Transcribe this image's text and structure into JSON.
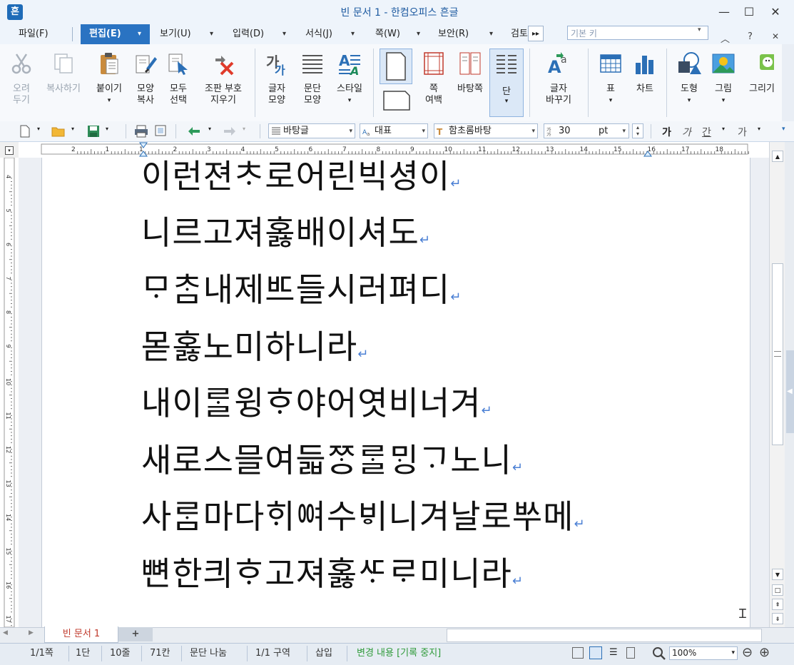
{
  "window": {
    "title": "빈 문서 1 - 한컴오피스 흔글",
    "app_icon_glyph": "흔",
    "minimize": "—",
    "maximize": "☐",
    "close": "✕"
  },
  "menu": {
    "file": "파일(F)",
    "edit": "편집(E)",
    "view": "보기(U)",
    "input": "입력(D)",
    "format": "서식(J)",
    "page": "쪽(W)",
    "security": "보안(R)",
    "review": "검토",
    "arrow": "▾",
    "more": "▸▸",
    "style_box_placeholder": "기본 키",
    "ribbon_collapse": "︿",
    "help": "?",
    "close_doc": "✕"
  },
  "ribbon": {
    "cut": "오려\n두기",
    "copy": "복사하기",
    "paste": "붙이기",
    "format_copy": "모양\n복사",
    "select_all": "모두\n선택",
    "remove_format": "조판 부호\n지우기",
    "char_shape": "글자\n모양",
    "para_shape": "문단\n모양",
    "style": "스타일",
    "page_margin": "쪽\n여백",
    "background": "바탕쪽",
    "column": "단",
    "char_change": "글자\n바꾸기",
    "table": "표",
    "chart": "차트",
    "shape": "도형",
    "picture": "그림",
    "draw": "그리기"
  },
  "toolbar2": {
    "style_combo": "바탕글",
    "lang_combo": "대표",
    "font_combo": "함초롬바탕",
    "size_value": "30",
    "size_unit": "pt",
    "bold": "가",
    "italic": "가",
    "underline": "간",
    "strike": "가"
  },
  "ruler": {
    "h_numbers": [
      "2",
      "1",
      "1",
      "2",
      "3",
      "4",
      "5",
      "6",
      "7",
      "8",
      "9",
      "10",
      "11",
      "12",
      "13",
      "14",
      "15",
      "16",
      "17",
      "18"
    ],
    "v_numbers": [
      "4",
      "5",
      "6",
      "7",
      "8",
      "9",
      "10",
      "11",
      "12",
      "13",
      "14",
      "15",
      "16",
      "17"
    ]
  },
  "document": {
    "lines": [
      "이런젼ᄎᆞ로어린빅셩이",
      "니르고져홇배이셔도",
      "ᄆᆞᄎᆞᆷ내제ᄠᅳ들시러펴디",
      "몯홇노미하니라",
      "내이ᄅᆞᆯ윙ᄒᆞ야어엿비너겨",
      "새로스믈여듧ᄍᆞᆼᄅᆞᆯᄆᆡᆼᄀᆞ노니",
      "사ᄅᆞᆷ마다ᄒᆡᅇᅧ수ᄫᅵ니겨날로ᄡᅮ메",
      "뼌한킈ᄒᆞ고져홇ᄯᆞᄅᆞ미니라"
    ],
    "para_mark": "↵",
    "tab_name": "빈 문서 1",
    "add_tab": "+"
  },
  "status": {
    "page": "1/1쪽",
    "column": "1단",
    "line": "10줄",
    "col": "71칸",
    "break": "문단 나눔",
    "section": "1/1 구역",
    "insert": "삽입",
    "track": "변경 내용 [기록 중지]",
    "zoom": "100%",
    "zoom_out": "⊖",
    "zoom_in": "⊕"
  },
  "colors": {
    "accent": "#2a73c2",
    "title_text": "#1d5aa0",
    "track_text": "#2f9a3a",
    "tab_text": "#c0392b"
  }
}
